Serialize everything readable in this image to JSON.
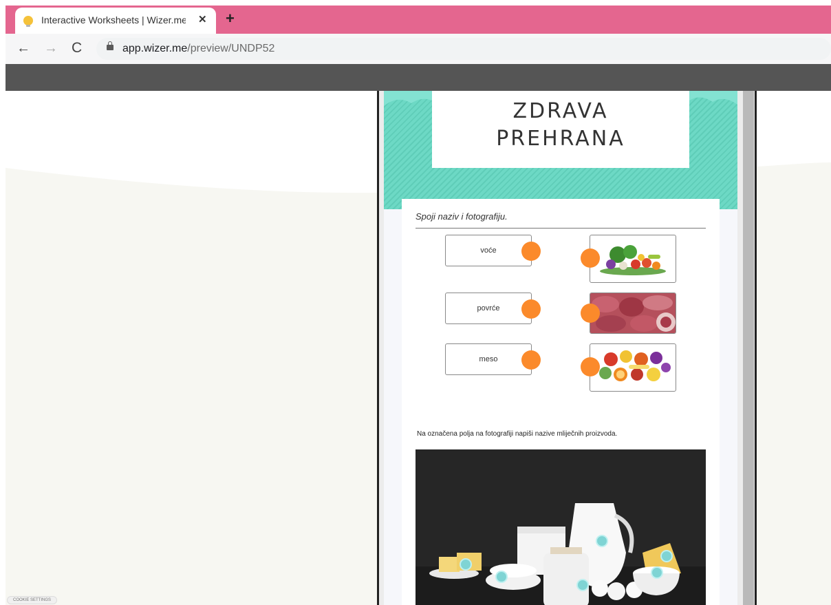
{
  "browser": {
    "tab_title": "Interactive Worksheets | Wizer.me",
    "tab_close": "✕",
    "new_tab": "+",
    "back": "←",
    "forward": "→",
    "reload": "C",
    "url_host": "app.wizer.me",
    "url_path": "/preview/UNDP52",
    "accent_color": "#e4668f"
  },
  "worksheet": {
    "title_line1": "ZDRAVA",
    "title_line2": "PREHRANA",
    "instruction_match": "Spoji naziv i fotografiju.",
    "match_words": [
      "voće",
      "povrće",
      "meso"
    ],
    "match_images": [
      "vegetables-image",
      "meat-image",
      "fruit-image"
    ],
    "instruction_label": "Na označena polja na fotografiji napiši nazive mliječnih proizvoda.",
    "photo_icon": "dairy-products-photo",
    "connector_color": "#fb8a2b",
    "hotspot_color": "#7fd4d4"
  },
  "footer": {
    "cookie_settings": "COOKIE SETTINGS"
  }
}
